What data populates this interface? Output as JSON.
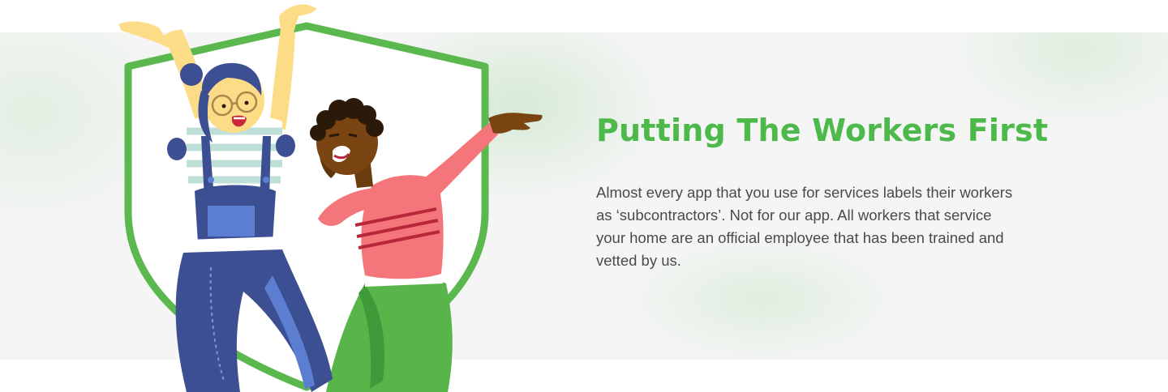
{
  "section": {
    "title": "Putting The Workers First",
    "body": "Almost every app that you use for services labels their workers as ‘subcontractors’. Not for our app. All workers that service your home are an official employee that has been trained and vetted by us."
  },
  "illustration": {
    "icon": "shield-with-two-workers-icon",
    "colors": {
      "shield_border": "#5bb84f",
      "title_green": "#4cb94a",
      "overalls": "#3d4f93",
      "sweater": "#f4767a",
      "pants": "#57b54a"
    }
  }
}
